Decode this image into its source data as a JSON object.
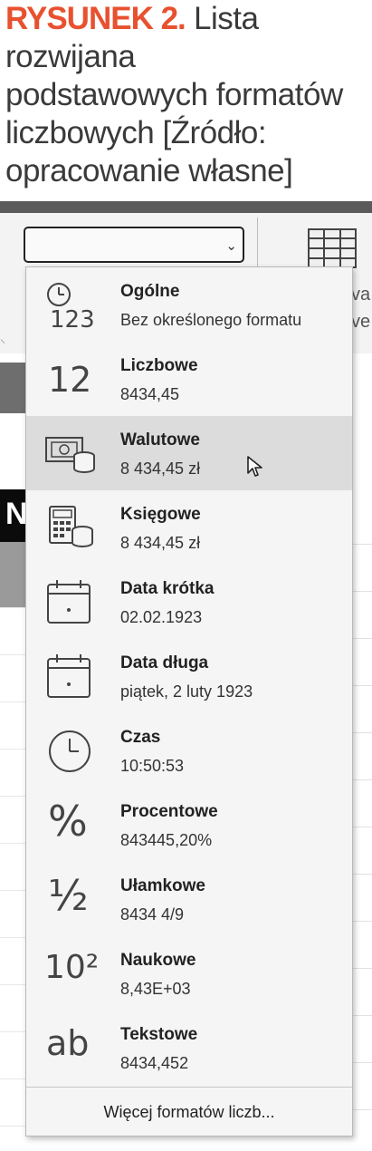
{
  "caption": {
    "label": "RYSUNEK 2.",
    "text_line1": " Lista rozwijana",
    "text_line2": "podstawowych formatów",
    "text_line3": "liczbowych [Źródło:",
    "text_line4": "opracowanie własne]"
  },
  "ribbon": {
    "combo_value": "",
    "side_text_1": "va",
    "side_text_2": "ve"
  },
  "menu": {
    "items": [
      {
        "label": "Ogólne",
        "sample": "Bez określonego formatu",
        "icon": "general-number-icon",
        "icon_text": "123"
      },
      {
        "label": "Liczbowe",
        "sample": "8434,45",
        "icon": "number-icon",
        "icon_text": "12"
      },
      {
        "label": "Walutowe",
        "sample": "8 434,45 zł",
        "icon": "currency-icon",
        "selected": true
      },
      {
        "label": "Księgowe",
        "sample": " 8 434,45 zł",
        "icon": "accounting-icon"
      },
      {
        "label": "Data krótka",
        "sample": "02.02.1923",
        "icon": "calendar-short-icon"
      },
      {
        "label": "Data długa",
        "sample": "piątek, 2 luty 1923",
        "icon": "calendar-long-icon"
      },
      {
        "label": "Czas",
        "sample": "10:50:53",
        "icon": "clock-icon"
      },
      {
        "label": "Procentowe",
        "sample": "843445,20%",
        "icon": "percent-icon",
        "icon_text": "%"
      },
      {
        "label": "Ułamkowe",
        "sample": "8434 4/9",
        "icon": "fraction-icon",
        "icon_text": "½"
      },
      {
        "label": "Naukowe",
        "sample": "8,43E+03",
        "icon": "scientific-icon",
        "icon_text": "10²"
      },
      {
        "label": "Tekstowe",
        "sample": "8434,452",
        "icon": "text-format-icon",
        "icon_text": "ab"
      }
    ],
    "more_label": "Więcej formatów liczb..."
  },
  "worksheet": {
    "visible_letter": "N"
  }
}
